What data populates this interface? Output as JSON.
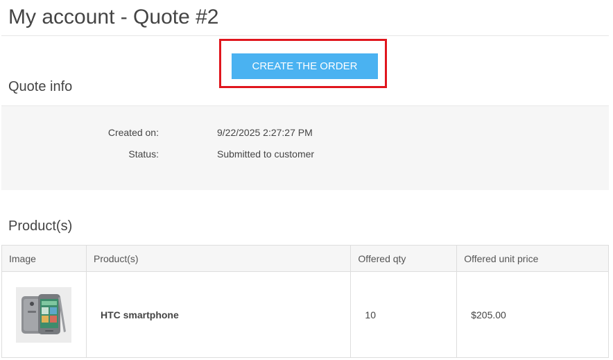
{
  "page": {
    "title": "My account - Quote #2"
  },
  "actions": {
    "create_order_label": "CREATE THE ORDER"
  },
  "quote_info": {
    "title": "Quote info",
    "created_on_label": "Created on:",
    "created_on_value": "9/22/2025 2:27:27 PM",
    "status_label": "Status:",
    "status_value": "Submitted to customer"
  },
  "products": {
    "title": "Product(s)",
    "columns": [
      "Image",
      "Product(s)",
      "Offered qty",
      "Offered unit price"
    ],
    "rows": [
      {
        "image_icon": "smartphone-image",
        "name": "HTC smartphone",
        "qty": "10",
        "unit_price": "$205.00"
      }
    ]
  },
  "colors": {
    "button": "#4ab2f1",
    "highlight": "#e0161d",
    "panel": "#f6f6f6"
  }
}
